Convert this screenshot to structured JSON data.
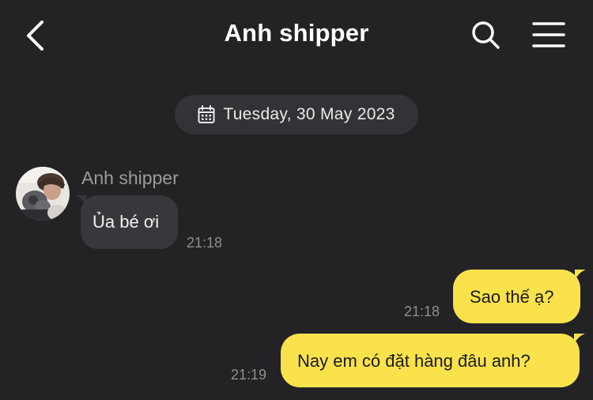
{
  "header": {
    "title": "Anh shipper",
    "back_icon": "chevron-left-icon",
    "search_icon": "search-icon",
    "menu_icon": "hamburger-menu-icon"
  },
  "date_chip": {
    "icon": "calendar-icon",
    "label": "Tuesday, 30 May 2023"
  },
  "messages": [
    {
      "direction": "incoming",
      "sender": "Anh shipper",
      "text": "Ủa bé ơi",
      "time": "21:18"
    },
    {
      "direction": "outgoing",
      "text": "Sao thế ạ?",
      "time": "21:18"
    },
    {
      "direction": "outgoing",
      "text": "Nay em có đặt hàng đâu anh?",
      "time": "21:19"
    }
  ],
  "colors": {
    "background": "#232326",
    "incoming_bubble": "#38383c",
    "outgoing_bubble": "#f9e24b",
    "date_chip": "#333337",
    "muted_text": "#8f8f93"
  }
}
